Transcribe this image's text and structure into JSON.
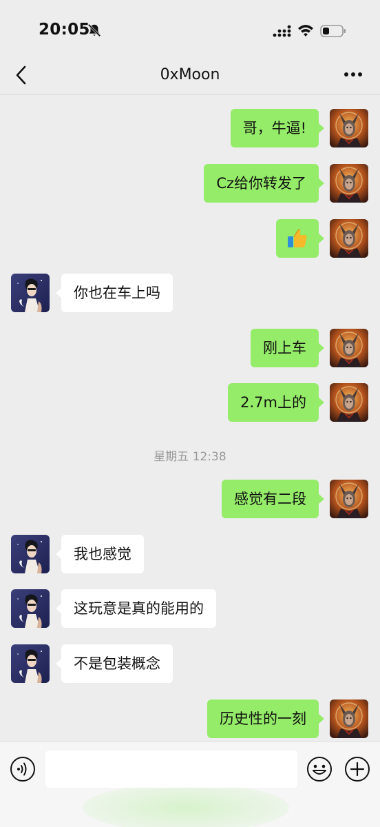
{
  "status_bar": {
    "time": "20:05",
    "icons": [
      "bell-off-icon",
      "cellular-signal-icon",
      "wifi-icon",
      "battery-icon"
    ]
  },
  "nav": {
    "title": "0xMoon",
    "icons": [
      "back-chevron-icon",
      "more-dots-icon"
    ]
  },
  "messages": [
    {
      "from": "me",
      "text": "哥，牛逼!"
    },
    {
      "from": "me",
      "text": "Cz给你转发了"
    },
    {
      "from": "me",
      "text": "",
      "emoji": "thumbs-up-icon"
    },
    {
      "from": "other",
      "text": "你也在车上吗"
    },
    {
      "from": "me",
      "text": "刚上车"
    },
    {
      "from": "me",
      "text": "2.7m上的"
    },
    {
      "timestamp": "星期五 12:38"
    },
    {
      "from": "me",
      "text": "感觉有二段"
    },
    {
      "from": "other",
      "text": "我也感觉"
    },
    {
      "from": "other",
      "text": "这玩意是真的能用的"
    },
    {
      "from": "other",
      "text": "不是包装概念"
    },
    {
      "from": "me",
      "text": "历史性的一刻"
    }
  ],
  "input_bar": {
    "value": "",
    "icons": [
      "voice-icon",
      "emoji-icon",
      "plus-icon"
    ]
  },
  "colors": {
    "background": "#ededed",
    "my_bubble": "#95ec69",
    "their_bubble": "#ffffff",
    "timestamp_text": "#9a9a9a"
  }
}
